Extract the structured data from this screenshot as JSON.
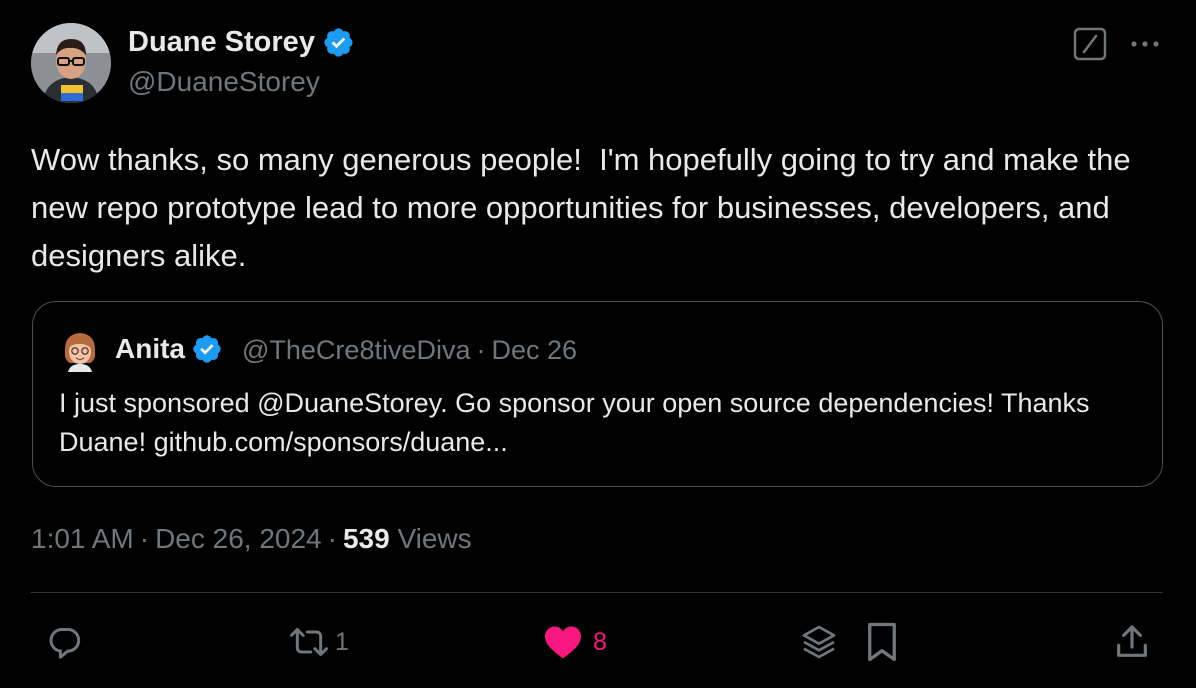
{
  "author": {
    "name": "Duane Storey",
    "handle": "@DuaneStorey"
  },
  "tweet": {
    "text": "Wow thanks, so many generous people!  I'm hopefully going to try and make the new repo prototype lead to more opportunities for businesses, developers, and designers alike."
  },
  "quote": {
    "name": "Anita",
    "handle": "@TheCre8tiveDiva",
    "separator": "·",
    "date": "Dec 26",
    "text": "I just sponsored @DuaneStorey. Go sponsor your open source dependencies! Thanks Duane! github.com/sponsors/duane..."
  },
  "meta": {
    "time": "1:01 AM",
    "separator": "·",
    "date": "Dec 26, 2024",
    "views_count": "539",
    "views_label": "Views"
  },
  "actions": {
    "retweet_count": "1",
    "like_count": "8"
  },
  "colors": {
    "background": "#000000",
    "text": "#e7e9ea",
    "muted": "#71767b",
    "verified": "#1d9bf0",
    "like": "#f91880",
    "border": "#2f3336"
  },
  "icons": {
    "verified": "verified-badge-icon",
    "grok": "grok-icon",
    "more": "more-icon",
    "reply": "reply-icon",
    "retweet": "retweet-icon",
    "like": "heart-icon",
    "layers": "layers-icon",
    "bookmark": "bookmark-icon",
    "share": "share-icon"
  }
}
